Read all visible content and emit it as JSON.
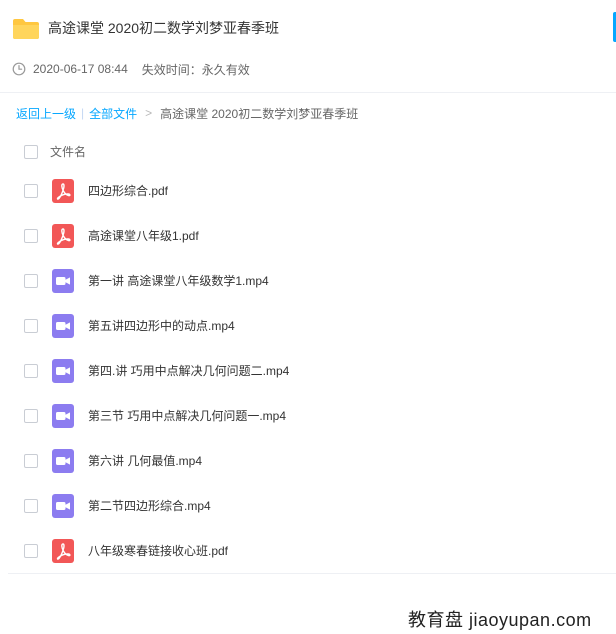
{
  "share": {
    "title": "高途课堂 2020初二数学刘梦亚春季班",
    "date": "2020-06-17 08:44",
    "expiry": "失效时间：永久有效"
  },
  "breadcrumb": {
    "back": "返回上一级",
    "separator": "|",
    "all_files": "全部文件",
    "arrow": ">",
    "current": "高途课堂 2020初二数学刘梦亚春季班"
  },
  "columns": {
    "name": "文件名"
  },
  "files": [
    {
      "name": "四边形综合.pdf",
      "type": "pdf"
    },
    {
      "name": "高途课堂八年级1.pdf",
      "type": "pdf"
    },
    {
      "name": "第一讲 高途课堂八年级数学1.mp4",
      "type": "video"
    },
    {
      "name": "第五讲四边形中的动点.mp4",
      "type": "video"
    },
    {
      "name": "第四.讲 巧用中点解决几何问题二.mp4",
      "type": "video"
    },
    {
      "name": "第三节 巧用中点解决几何问题一.mp4",
      "type": "video"
    },
    {
      "name": "第六讲 几何最值.mp4",
      "type": "video"
    },
    {
      "name": "第二节四边形综合.mp4",
      "type": "video"
    },
    {
      "name": "八年级寒春链接收心班.pdf",
      "type": "pdf"
    }
  ],
  "watermark": "教育盘 jiaoyupan.com",
  "icons": {
    "folder": "folder-icon",
    "clock": "clock-icon",
    "pdf": "pdf-icon",
    "video": "video-icon"
  },
  "colors": {
    "accent": "#06a7ff",
    "folder": "#ffc740",
    "pdf": "#f25757",
    "video": "#8c7cf0"
  }
}
